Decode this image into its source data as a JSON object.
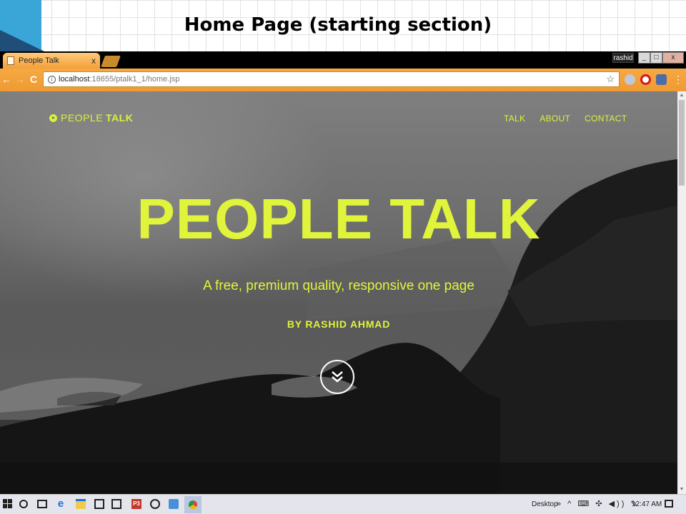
{
  "slide": {
    "title": "Home Page (starting section)"
  },
  "browser": {
    "tab_title": "People Talk",
    "tab_close": "x",
    "profile_name": "rashid",
    "win_min": "_",
    "win_max": "□",
    "win_close": "x",
    "nav_back": "←",
    "nav_forward": "→",
    "nav_reload": "C",
    "url_host": "localhost",
    "url_path": ":18655/ptalk1_1/home.jsp",
    "info_icon": "i",
    "star_icon": "☆",
    "menu_icon": "⋮"
  },
  "site": {
    "brand_part1": "PEOPLE",
    "brand_part2": "TALK",
    "nav": [
      "TALK",
      "ABOUT",
      "CONTACT"
    ],
    "hero_title": "PEOPLE TALK",
    "hero_subtitle": "A free, premium quality, responsive one page",
    "hero_byline": "BY RASHID AHMAD",
    "accent_color": "#dcf13a"
  },
  "taskbar": {
    "ppt_label": "P3",
    "desktop_label": "Desktop",
    "tray": "» ^ ⌨ ✣ ◀)) ✎",
    "time": "12:47 AM"
  }
}
